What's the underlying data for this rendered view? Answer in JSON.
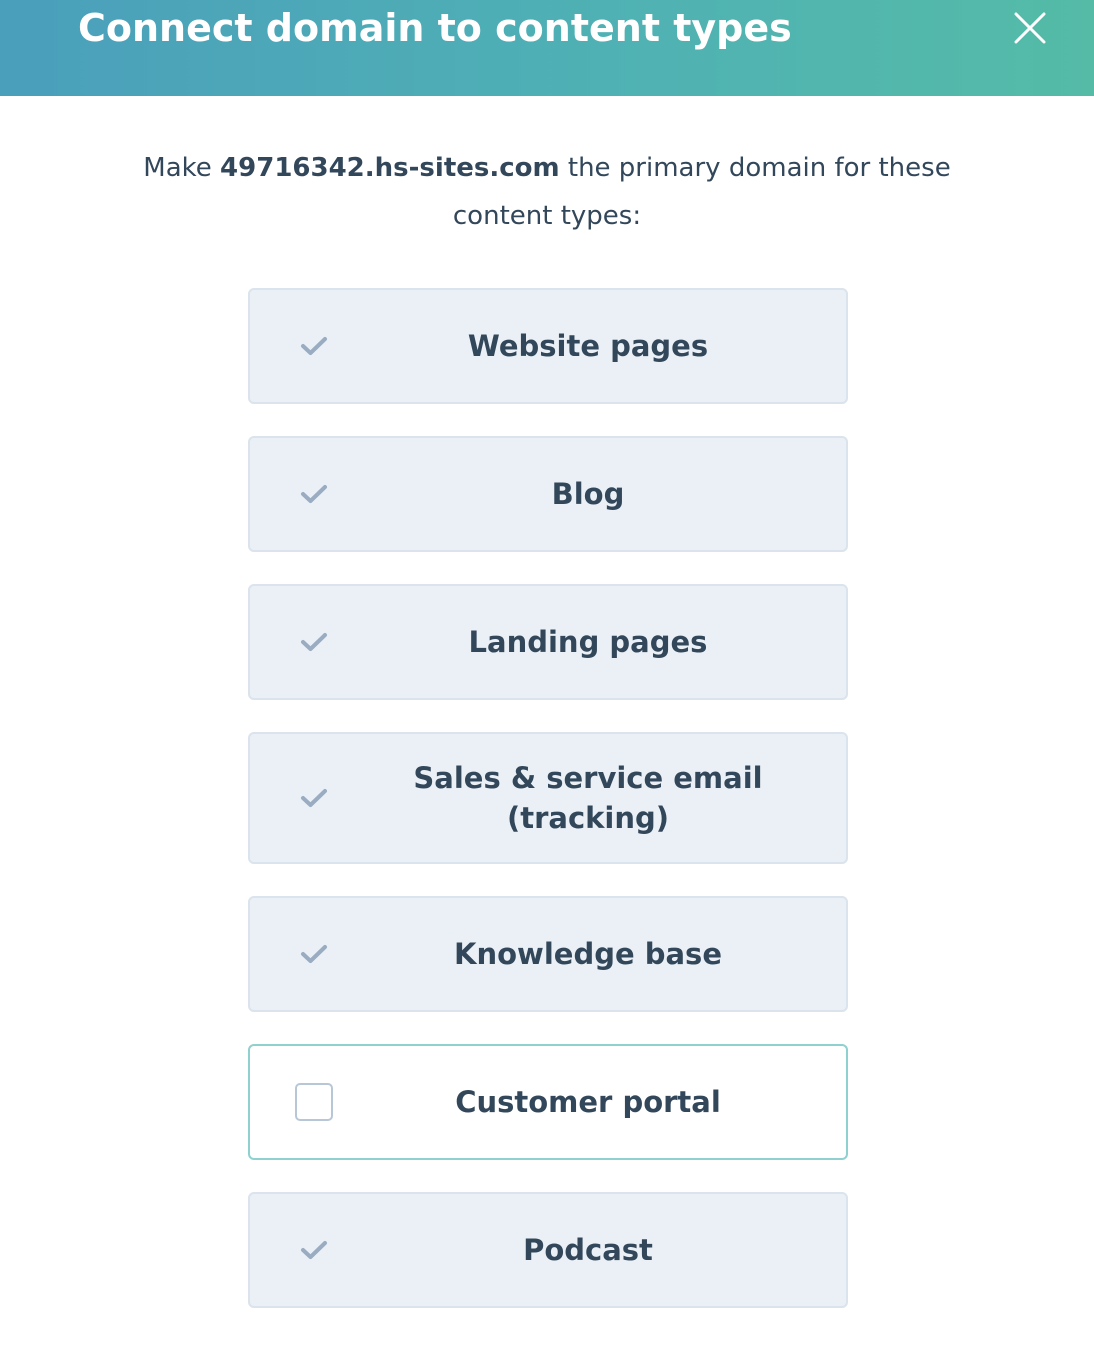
{
  "header": {
    "title": "Connect domain to content types",
    "close_icon": "close-icon"
  },
  "intro": {
    "prefix": "Make ",
    "domain": "49716342.hs-sites.com",
    "suffix": " the primary domain for these content types:"
  },
  "options": [
    {
      "label": "Website pages",
      "checked": true
    },
    {
      "label": "Blog",
      "checked": true
    },
    {
      "label": "Landing pages",
      "checked": true
    },
    {
      "label": "Sales & service email (tracking)",
      "checked": true
    },
    {
      "label": "Knowledge base",
      "checked": true
    },
    {
      "label": "Customer portal",
      "checked": false
    },
    {
      "label": "Podcast",
      "checked": true
    }
  ],
  "colors": {
    "header_gradient_start": "#4a9fbb",
    "header_gradient_end": "#55bba7",
    "text": "#33475b",
    "option_bg": "#eaf0f6",
    "check_icon": "#99acc2",
    "unchecked_border": "#8fd1cf"
  }
}
